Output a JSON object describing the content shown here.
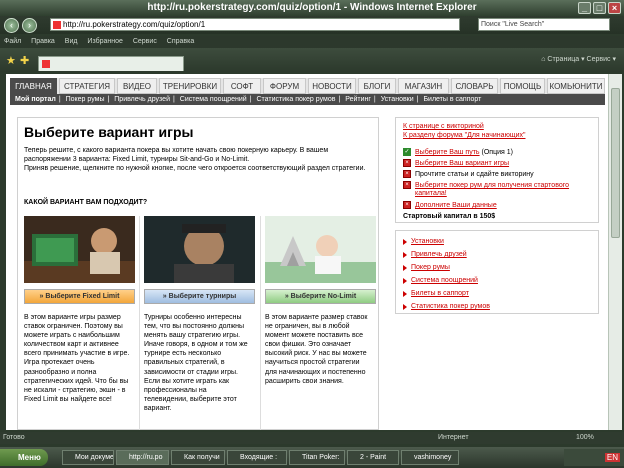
{
  "window": {
    "title": "http://ru.pokerstrategy.com/quiz/option/1 - Windows Internet Explorer"
  },
  "browser": {
    "address": "http://ru.pokerstrategy.com/quiz/option/1",
    "search_placeholder": "Поиск \"Live Search\"",
    "menu": [
      "Файл",
      "Правка",
      "Вид",
      "Избранное",
      "Сервис",
      "Справка"
    ],
    "page_label": "Страница",
    "service_label": "Сервис",
    "status": "Готово",
    "zone": "Интернет",
    "zoom": "100%"
  },
  "site": {
    "nav": [
      "ГЛАВНАЯ",
      "СТРАТЕГИЯ",
      "ВИДЕО",
      "ТРЕНИРОВКИ",
      "СОФТ",
      "ФОРУМ",
      "НОВОСТИ",
      "БЛОГИ",
      "МАГАЗИН",
      "СЛОВАРЬ",
      "ПОМОЩЬ",
      "КОМЬЮНИТИ"
    ],
    "subnav": [
      "Мой портал",
      "Покер румы",
      "Привлечь друзей",
      "Система поощрений",
      "Статистика покер румов",
      "Рейтинг",
      "Установки",
      "Билеты в саппорт"
    ]
  },
  "main": {
    "title": "Выберите вариант игры",
    "intro1": "Теперь решите, с какого варианта покера вы хотите начать свою покерную карьеру. В вашем распоряжении 3 варианта: Fixed Limit, турниры Sit-and-Go и No-Limit.",
    "intro2": "Приняв решение, щелкните по нужной кнопке, после чего откроется соответствующий раздел стратегии.",
    "question": "КАКОЙ ВАРИАНТ ВАМ ПОДХОДИТ?",
    "options": [
      {
        "label": "» Выберите Fixed Limit",
        "text": "В этом варианте игры размер ставок ограничен. Поэтому вы можете играть с наибольшим количеством карт и активнее всего принимать участие в игре. Игра протекает очень разнообразно и полна стратегических идей. Что бы вы не искали - стратегию, экшн - в Fixed Limit вы найдете все!"
      },
      {
        "label": "» Выберите турниры",
        "text": "Турниры особенно интересны тем, что вы постоянно должны менять вашу стратегию игры. Иначе говоря, в одном и том же турнире есть несколько правильных стратегий, в зависимости от стадии игры. Если вы хотите играть как профессионалы на телевидении, выберите этот вариант."
      },
      {
        "label": "» Выберите No-Limit",
        "text": "В этом варианте размер ставок не ограничен, вы в любой момент можете поставить все свои фишки. Это означает высокий риск. У нас вы можете научиться простой стратегии для начинающих и постепенно расширить свои знания."
      }
    ]
  },
  "side": {
    "top_links": [
      "К странице с викториной",
      "К разделу форума \"Для начинающих\""
    ],
    "steps": [
      {
        "text": "Выберите Ваш путь",
        "extra": "(Опция 1)",
        "done": true
      },
      {
        "text": "Выберите Ваш вариант игры",
        "extra": "",
        "done": false
      },
      {
        "text": "Прочтите статьи и сдайте викторину",
        "extra": "",
        "done": false
      },
      {
        "text": "Выберите покер рум для получения стартового капитала!",
        "extra": "",
        "done": false
      },
      {
        "text": "Дополните Ваши данные",
        "extra": "",
        "done": false
      }
    ],
    "capital": "Стартовый капитал в 150$",
    "links": [
      "Установки",
      "Привлечь друзей",
      "Покер румы",
      "Система поощрений",
      "Билеты в саппорт",
      "Статистика покер румов"
    ]
  },
  "taskbar": {
    "start": "Меню",
    "items": [
      "Мои докуме",
      "http://ru.po",
      "Как получи",
      "Входящие :",
      "Titan Poker:",
      "2 - Paint",
      "vashimoney"
    ],
    "lang": "EN",
    "clock": ""
  }
}
